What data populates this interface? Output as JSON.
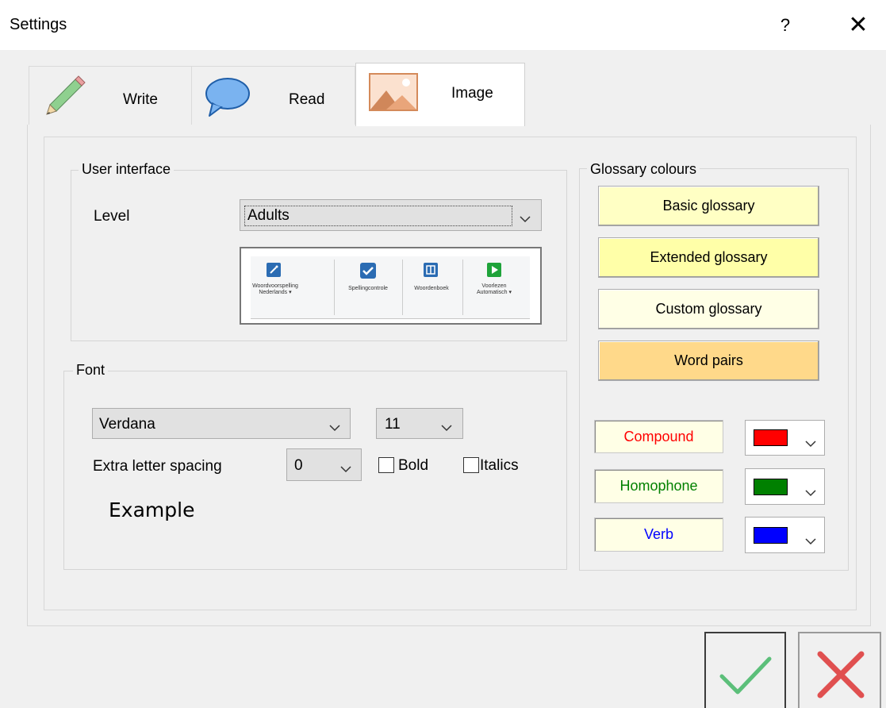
{
  "window": {
    "title": "Settings",
    "help_label": "?",
    "close_label": "✕"
  },
  "tabs": [
    {
      "label": "Write",
      "icon": "pencil-icon"
    },
    {
      "label": "Read",
      "icon": "speech-bubble-icon"
    },
    {
      "label": "Image",
      "icon": "picture-icon",
      "selected": true
    }
  ],
  "user_interface": {
    "legend": "User interface",
    "level_label": "Level",
    "level_value": "Adults",
    "preview_items": [
      {
        "label": "Woordvoorspelling\nNederlands ▾",
        "icon": "magic-wand-icon"
      },
      {
        "label": "Spellingcontrole",
        "icon": "checkmark-icon"
      },
      {
        "label": "Woordenboek",
        "icon": "book-icon"
      },
      {
        "label": "Voorlezen\nAutomatisch ▾",
        "icon": "play-icon"
      }
    ]
  },
  "font": {
    "legend": "Font",
    "family_value": "Verdana",
    "size_value": "11",
    "extra_spacing_label": "Extra letter spacing",
    "extra_spacing_value": "0",
    "bold_label": "Bold",
    "italics_label": "Italics",
    "bold_checked": false,
    "italics_checked": false,
    "example_text": "Example"
  },
  "glossary": {
    "legend": "Glossary colours",
    "buttons": [
      {
        "label": "Basic glossary",
        "color": "#ffffc4"
      },
      {
        "label": "Extended glossary",
        "color": "#ffffa8"
      },
      {
        "label": "Custom glossary",
        "color": "#ffffe6"
      },
      {
        "label": "Word pairs",
        "color": "#ffd98a"
      }
    ],
    "samples": [
      {
        "label": "Compound",
        "color": "#ff0000"
      },
      {
        "label": "Homophone",
        "color": "#008000"
      },
      {
        "label": "Verb",
        "color": "#0000ff"
      }
    ]
  },
  "actions": {
    "ok_icon": "green-checkmark-icon",
    "cancel_icon": "red-x-icon"
  }
}
